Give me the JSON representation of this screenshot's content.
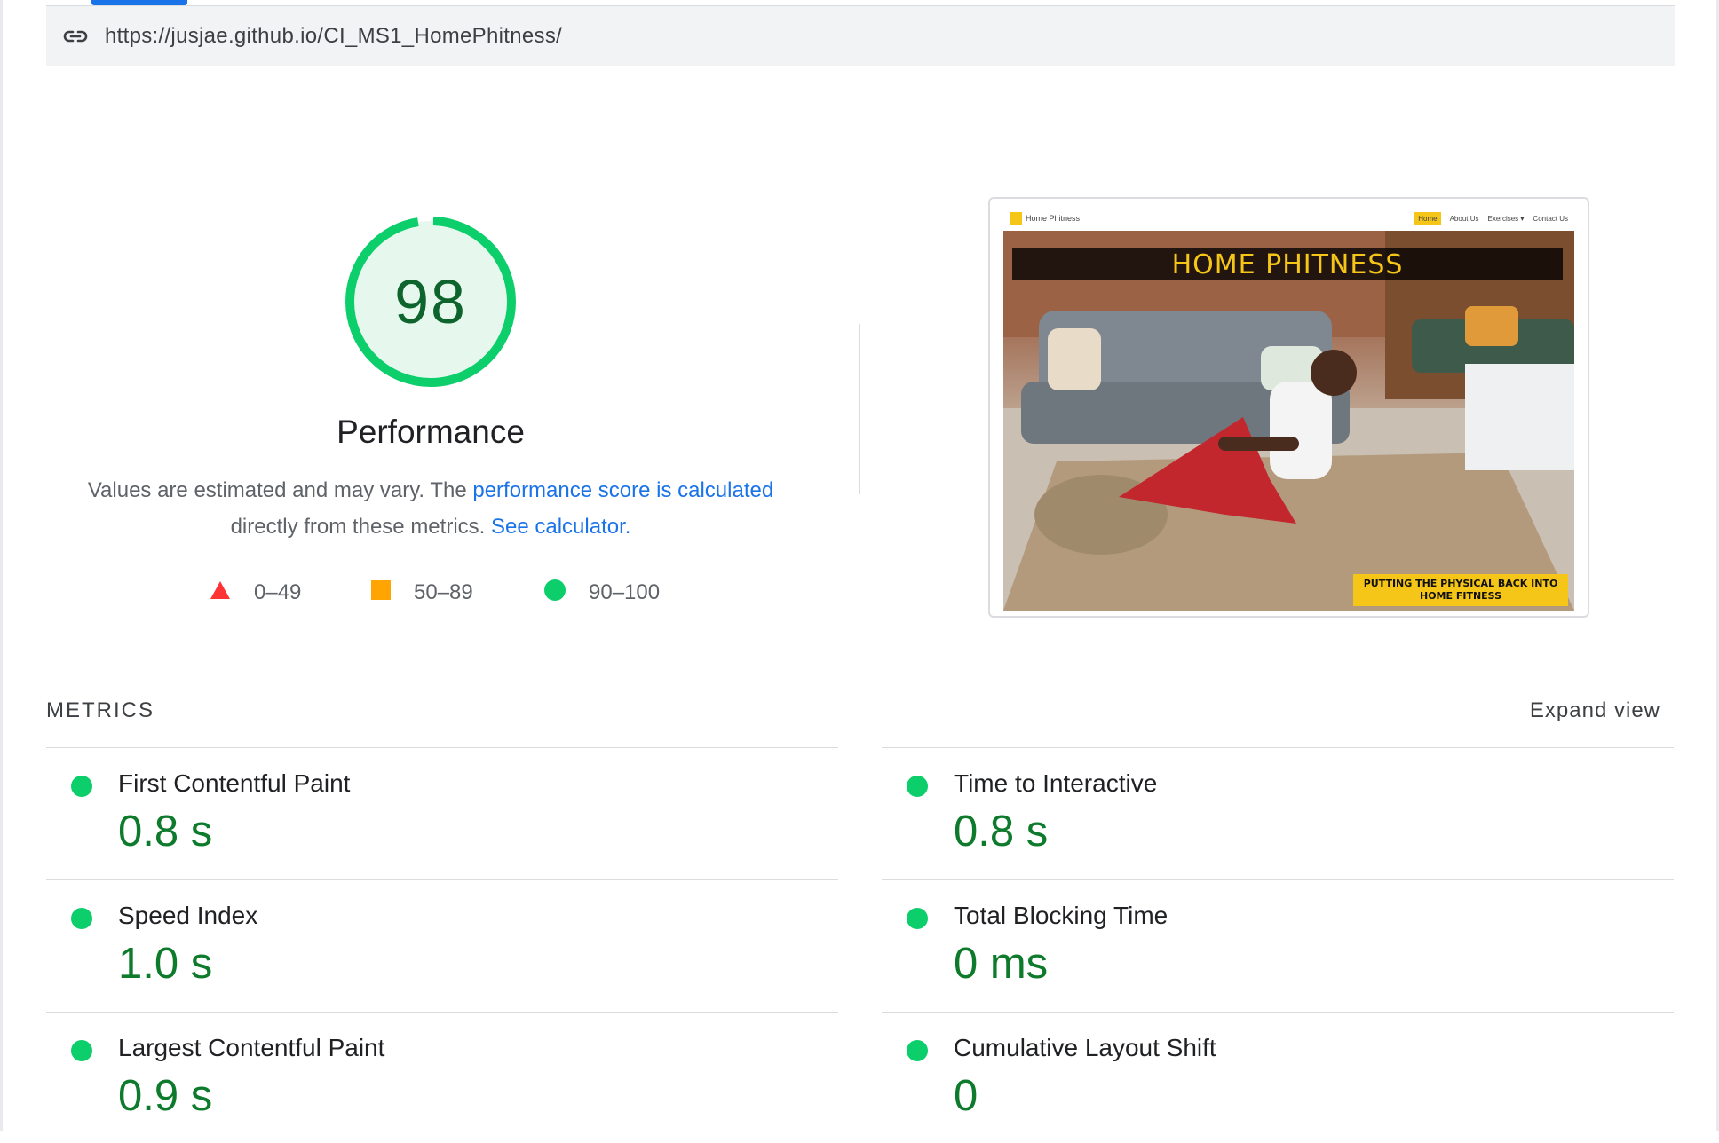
{
  "url_bar": {
    "url": "https://jusjae.github.io/CI_MS1_HomePhitness/"
  },
  "gauge": {
    "score": "98",
    "label": "Performance",
    "color": "#0cce6b"
  },
  "description": {
    "prefix": "Values are estimated and may vary. The ",
    "link1": "performance score is calculated",
    "middle": "directly from these metrics. ",
    "link2": "See calculator."
  },
  "legend": [
    {
      "shape": "triangle",
      "label": "0–49",
      "color": "#ff3333"
    },
    {
      "shape": "square",
      "label": "50–89",
      "color": "#ffa400"
    },
    {
      "shape": "circle",
      "label": "90–100",
      "color": "#0cce6b"
    }
  ],
  "screenshot": {
    "brand": "Home Phitness",
    "nav": [
      "Home",
      "About Us",
      "Exercises ▾",
      "Contact Us"
    ],
    "hero_title": "HOME PHITNESS",
    "tagline": "PUTTING THE PHYSICAL BACK INTO HOME FITNESS"
  },
  "metrics": {
    "heading": "METRICS",
    "expand": "Expand view",
    "items": [
      {
        "title": "First Contentful Paint",
        "value": "0.8 s"
      },
      {
        "title": "Time to Interactive",
        "value": "0.8 s"
      },
      {
        "title": "Speed Index",
        "value": "1.0 s"
      },
      {
        "title": "Total Blocking Time",
        "value": "0 ms"
      },
      {
        "title": "Largest Contentful Paint",
        "value": "0.9 s"
      },
      {
        "title": "Cumulative Layout Shift",
        "value": "0"
      }
    ]
  }
}
